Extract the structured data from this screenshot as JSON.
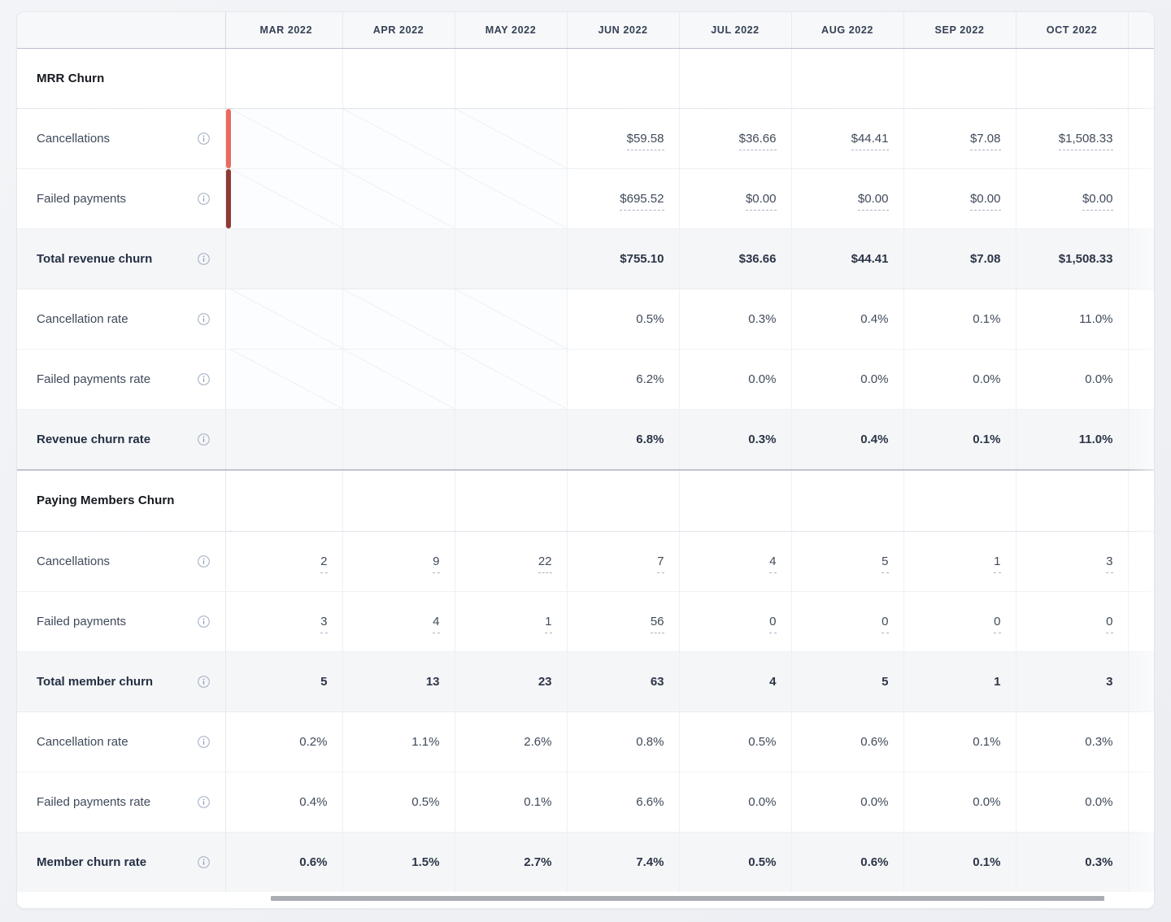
{
  "table": {
    "row_label_header": "",
    "columns": [
      "MAR 2022",
      "APR 2022",
      "MAY 2022",
      "JUN 2022",
      "JUL 2022",
      "AUG 2022",
      "SEP 2022",
      "OCT 2022"
    ],
    "no_data_marker": "",
    "sections": [
      {
        "title": "MRR Churn",
        "rows": [
          {
            "label": "Cancellations",
            "icon": "info-icon",
            "bar_color": "#ea6a5d",
            "emphasis": "normal",
            "underline": true,
            "values": [
              "",
              "",
              "",
              "$59.58",
              "$36.66",
              "$44.41",
              "$7.08",
              "$1,508.33"
            ]
          },
          {
            "label": "Failed payments",
            "icon": "info-icon",
            "bar_color": "#8e3a33",
            "emphasis": "normal",
            "underline": true,
            "values": [
              "",
              "",
              "",
              "$695.52",
              "$0.00",
              "$0.00",
              "$0.00",
              "$0.00"
            ]
          },
          {
            "label": "Total revenue churn",
            "icon": "info-icon",
            "bar_color": "",
            "emphasis": "total",
            "underline": false,
            "values": [
              "",
              "",
              "",
              "$755.10",
              "$36.66",
              "$44.41",
              "$7.08",
              "$1,508.33"
            ]
          },
          {
            "label": "Cancellation rate",
            "icon": "info-icon",
            "bar_color": "",
            "emphasis": "normal",
            "underline": false,
            "values": [
              "",
              "",
              "",
              "0.5%",
              "0.3%",
              "0.4%",
              "0.1%",
              "11.0%"
            ]
          },
          {
            "label": "Failed payments rate",
            "icon": "info-icon",
            "bar_color": "",
            "emphasis": "normal",
            "underline": false,
            "values": [
              "",
              "",
              "",
              "6.2%",
              "0.0%",
              "0.0%",
              "0.0%",
              "0.0%"
            ]
          },
          {
            "label": "Revenue churn rate",
            "icon": "info-icon",
            "bar_color": "",
            "emphasis": "total",
            "underline": false,
            "values": [
              "",
              "",
              "",
              "6.8%",
              "0.3%",
              "0.4%",
              "0.1%",
              "11.0%"
            ]
          }
        ]
      },
      {
        "title": "Paying Members Churn",
        "rows": [
          {
            "label": "Cancellations",
            "icon": "info-icon",
            "bar_color": "",
            "emphasis": "normal",
            "underline": true,
            "values": [
              "2",
              "9",
              "22",
              "7",
              "4",
              "5",
              "1",
              "3"
            ]
          },
          {
            "label": "Failed payments",
            "icon": "info-icon",
            "bar_color": "",
            "emphasis": "normal",
            "underline": true,
            "values": [
              "3",
              "4",
              "1",
              "56",
              "0",
              "0",
              "0",
              "0"
            ]
          },
          {
            "label": "Total member churn",
            "icon": "info-icon",
            "bar_color": "",
            "emphasis": "total",
            "underline": false,
            "values": [
              "5",
              "13",
              "23",
              "63",
              "4",
              "5",
              "1",
              "3"
            ]
          },
          {
            "label": "Cancellation rate",
            "icon": "info-icon",
            "bar_color": "",
            "emphasis": "normal",
            "underline": false,
            "values": [
              "0.2%",
              "1.1%",
              "2.6%",
              "0.8%",
              "0.5%",
              "0.6%",
              "0.1%",
              "0.3%"
            ]
          },
          {
            "label": "Failed payments rate",
            "icon": "info-icon",
            "bar_color": "",
            "emphasis": "normal",
            "underline": false,
            "values": [
              "0.4%",
              "0.5%",
              "0.1%",
              "6.6%",
              "0.0%",
              "0.0%",
              "0.0%",
              "0.0%"
            ]
          },
          {
            "label": "Member churn rate",
            "icon": "info-icon",
            "bar_color": "",
            "emphasis": "total",
            "underline": false,
            "values": [
              "0.6%",
              "1.5%",
              "2.7%",
              "7.4%",
              "0.5%",
              "0.6%",
              "0.1%",
              "0.3%"
            ]
          }
        ]
      }
    ]
  },
  "scrollbar": {
    "orientation": "horizontal",
    "name": "horizontal-scrollbar"
  },
  "colors": {
    "cancellations_series": "#ea6a5d",
    "failed_payments_series": "#8e3a33",
    "total_row_background": "#f5f6f8",
    "header_background": "#f7f8fa",
    "text_primary": "#3f4a5a"
  }
}
